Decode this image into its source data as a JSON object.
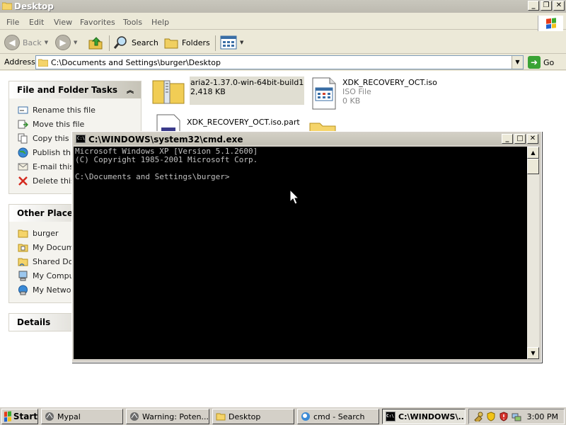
{
  "explorer": {
    "title": "Desktop",
    "window_buttons": [
      "_",
      "❐",
      "✕"
    ],
    "menu": [
      "File",
      "Edit",
      "View",
      "Favorites",
      "Tools",
      "Help"
    ],
    "toolbar": {
      "back_label": "Back",
      "search_label": "Search",
      "folders_label": "Folders"
    },
    "address": {
      "label": "Address",
      "value": "C:\\Documents and Settings\\burger\\Desktop",
      "go_label": "Go"
    },
    "file_tasks": {
      "title": "File and Folder Tasks",
      "items": [
        "Rename this file",
        "Move this file",
        "Copy this f",
        "Publish this",
        "E-mail this",
        "Delete this"
      ]
    },
    "other_places": {
      "title": "Other Places",
      "items": [
        "burger",
        "My Docume",
        "Shared Doc",
        "My Comput",
        "My Networ"
      ]
    },
    "details": {
      "title": "Details"
    },
    "files": [
      {
        "name": "aria2-1.37.0-win-64bit-build1",
        "sub": "2,418 KB"
      },
      {
        "name": "XDK_RECOVERY_OCT.iso",
        "type": "ISO File",
        "size": "0 KB"
      },
      {
        "name": "XDK_RECOVERY_OCT.iso.part"
      }
    ]
  },
  "cmd": {
    "title": "C:\\WINDOWS\\system32\\cmd.exe",
    "icon_text": "C:\\",
    "lines": [
      "Microsoft Windows XP [Version 5.1.2600]",
      "(C) Copyright 1985-2001 Microsoft Corp.",
      "",
      "C:\\Documents and Settings\\burger>"
    ]
  },
  "taskbar": {
    "start_label": "Start",
    "tasks": [
      "Mypal",
      "Warning: Poten...",
      "Desktop",
      "cmd - Search",
      "C:\\WINDOWS\\..."
    ],
    "clock": "3:00 PM"
  },
  "colors": {
    "cmd_background": "#000000",
    "cmd_text": "#c0c0c0",
    "chrome": "#ECE9D8",
    "go_green": "#3aa335"
  }
}
